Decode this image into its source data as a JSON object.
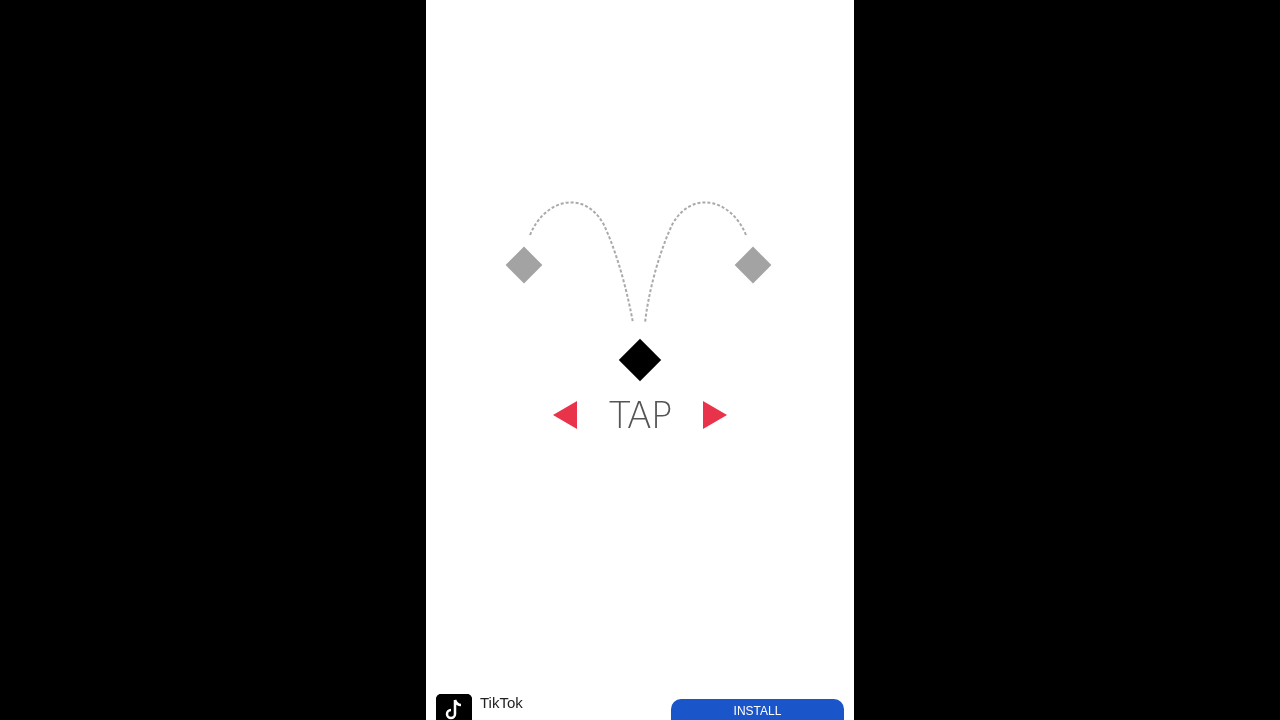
{
  "game": {
    "prompt": "TAP"
  },
  "ad": {
    "app_name": "TikTok",
    "button": "INSTALL"
  }
}
